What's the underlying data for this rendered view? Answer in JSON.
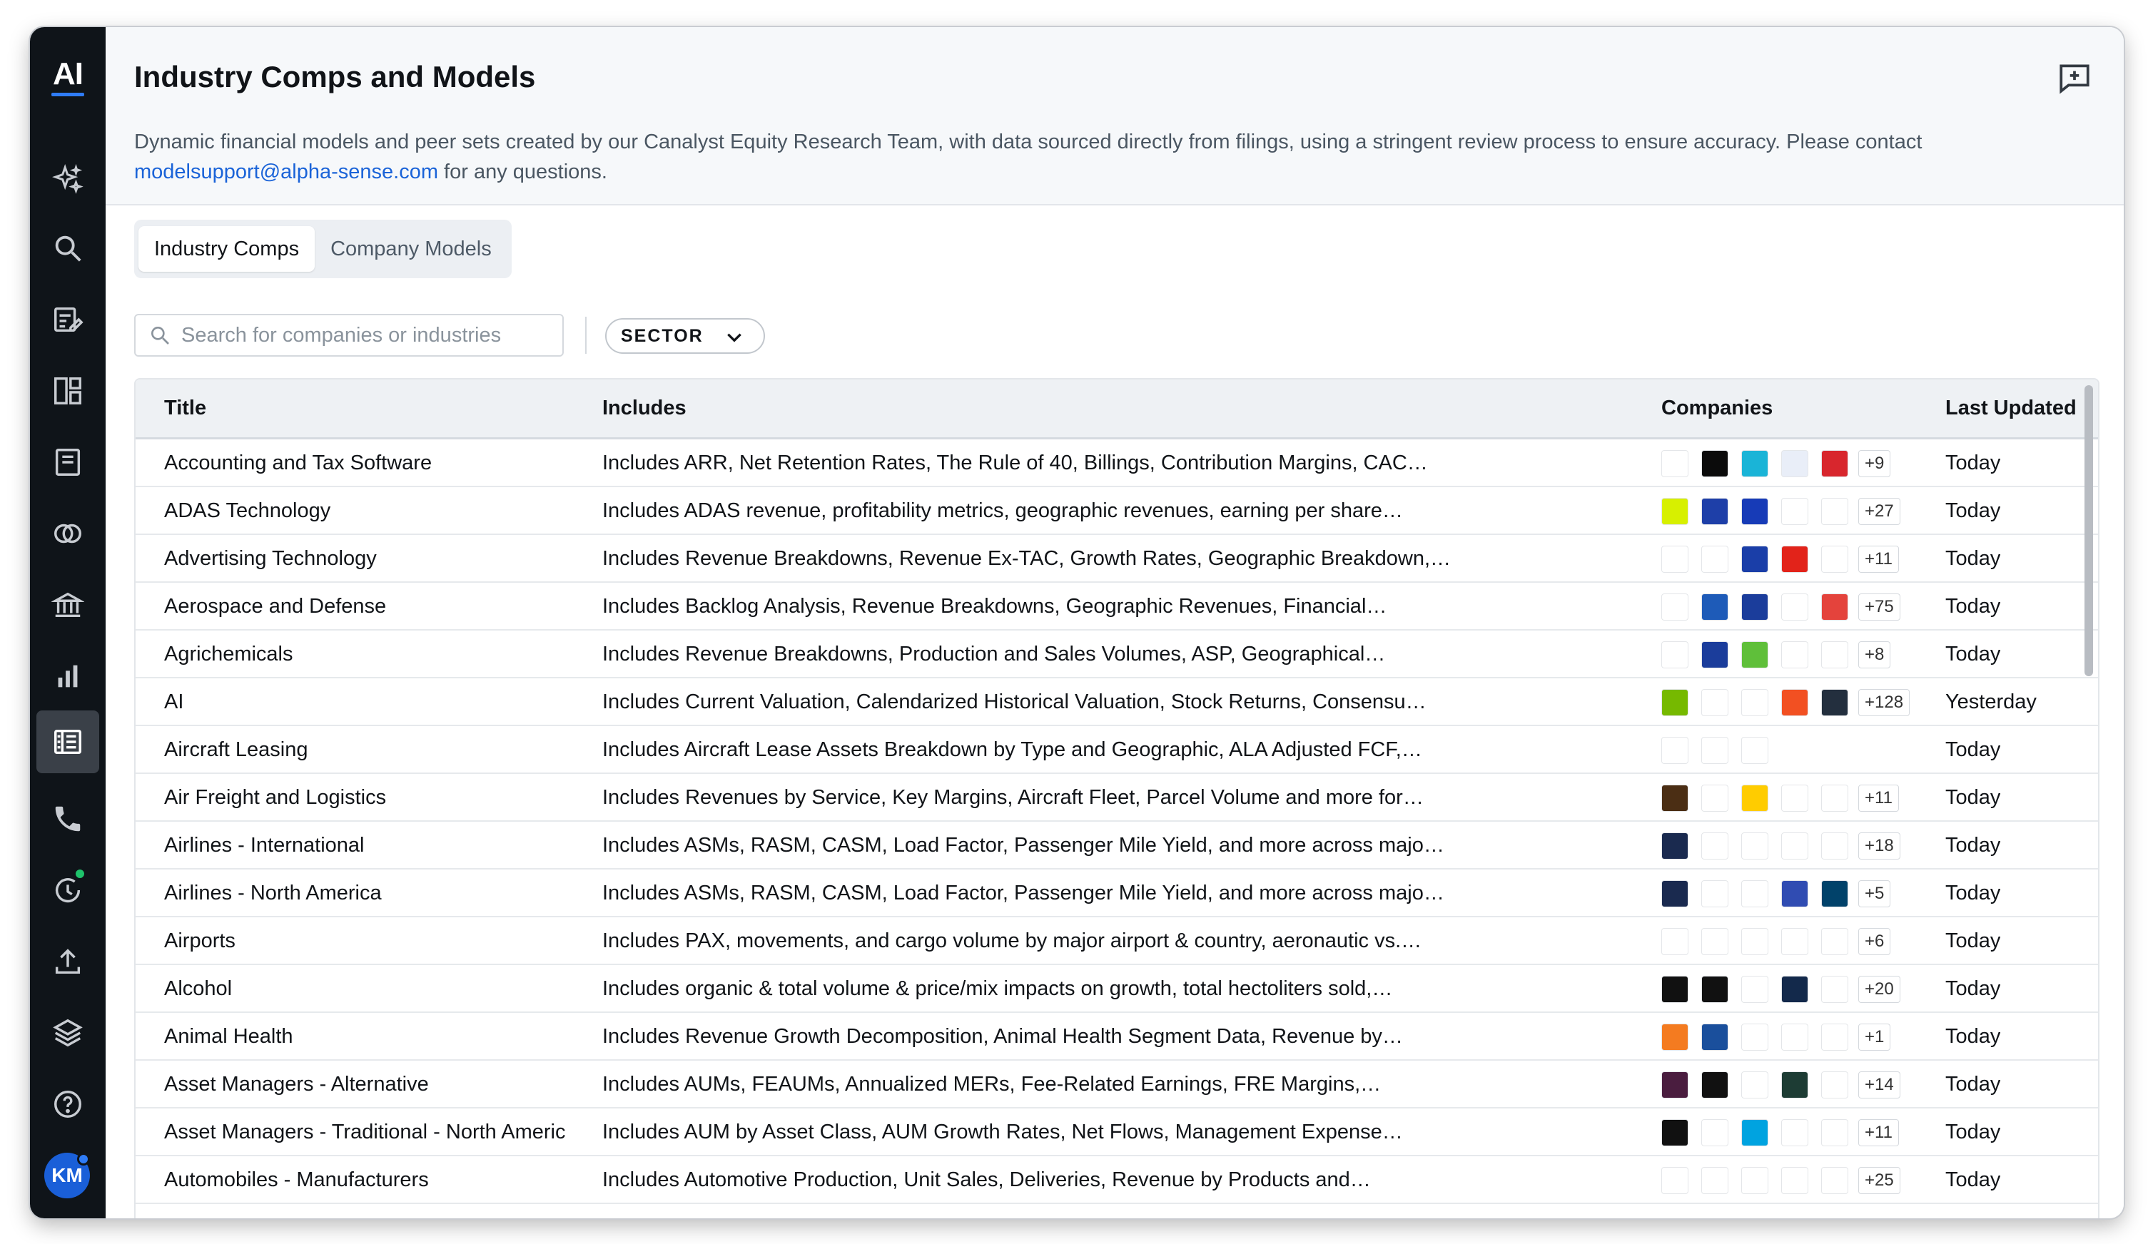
{
  "app": {
    "logo_text": "AI",
    "avatar_initials": "KM"
  },
  "sidebar": {
    "items": [
      {
        "icon": "sparkle-icon",
        "active": false
      },
      {
        "icon": "search-icon",
        "active": false
      },
      {
        "icon": "document-edit-icon",
        "active": false
      },
      {
        "icon": "dashboard-icon",
        "active": false
      },
      {
        "icon": "notebook-icon",
        "active": false
      },
      {
        "icon": "link-icon",
        "active": false
      },
      {
        "icon": "bank-icon",
        "active": false
      },
      {
        "icon": "bar-chart-icon",
        "active": false
      },
      {
        "icon": "table-list-icon",
        "active": true
      },
      {
        "icon": "phone-icon",
        "active": false
      },
      {
        "icon": "refresh-notification-icon",
        "active": false
      },
      {
        "icon": "upload-icon",
        "active": false
      },
      {
        "icon": "layers-icon",
        "active": false
      },
      {
        "icon": "help-icon",
        "active": false
      }
    ]
  },
  "header": {
    "title": "Industry Comps and Models",
    "description_text": "Dynamic financial models and peer sets created by our Canalyst Equity Research Team, with data sourced directly from filings, using a stringent review process to ensure accuracy. Please contact",
    "contact_email": "modelsupport@alpha-sense.com",
    "description_suffix": " for any questions."
  },
  "tabs": [
    {
      "label": "Industry Comps",
      "active": true
    },
    {
      "label": "Company Models",
      "active": false
    }
  ],
  "filters": {
    "search_placeholder": "Search for companies or industries",
    "sector_label": "SECTOR"
  },
  "table": {
    "columns": {
      "title": "Title",
      "includes": "Includes",
      "companies": "Companies",
      "updated": "Last Updated"
    },
    "rows": [
      {
        "title": "Accounting and Tax Software",
        "includes": "Includes ARR, Net Retention Rates, The Rule of 40, Billings, Contribution Margins, CAC…",
        "more": "+9",
        "updated": "Today",
        "logos": [
          "#ffffff",
          "#0b0b0b",
          "#1ab4d7",
          "#e9eef8",
          "#d8262d"
        ]
      },
      {
        "title": "ADAS Technology",
        "includes": "Includes ADAS revenue, profitability metrics, geographic revenues, earning per share…",
        "more": "+27",
        "updated": "Today",
        "logos": [
          "#d7f000",
          "#1e3fa8",
          "#173bb7",
          "#ffffff",
          "#ffffff"
        ]
      },
      {
        "title": "Advertising Technology",
        "includes": "Includes Revenue Breakdowns, Revenue Ex-TAC, Growth Rates, Geographic Breakdown,…",
        "more": "+11",
        "updated": "Today",
        "logos": [
          "#ffffff",
          "#ffffff",
          "#1a3ea8",
          "#e2231a",
          "#ffffff"
        ]
      },
      {
        "title": "Aerospace and Defense",
        "includes": "Includes Backlog Analysis, Revenue Breakdowns, Geographic Revenues, Financial…",
        "more": "+75",
        "updated": "Today",
        "logos": [
          "#ffffff",
          "#1e5bb8",
          "#1b3d9b",
          "#ffffff",
          "#e4433c"
        ]
      },
      {
        "title": "Agrichemicals",
        "includes": "Includes Revenue Breakdowns, Production and Sales Volumes, ASP, Geographical…",
        "more": "+8",
        "updated": "Today",
        "logos": [
          "#ffffff",
          "#1b3d9b",
          "#5fbf3a",
          "#ffffff",
          "#ffffff"
        ]
      },
      {
        "title": "AI",
        "includes": "Includes Current Valuation, Calendarized Historical Valuation, Stock Returns, Consensu…",
        "more": "+128",
        "updated": "Yesterday",
        "logos": [
          "#76b900",
          "#ffffff",
          "#ffffff",
          "#f25022",
          "#232f3e"
        ]
      },
      {
        "title": "Aircraft Leasing",
        "includes": "Includes Aircraft Lease Assets Breakdown by Type and Geographic, ALA Adjusted FCF,…",
        "more": "",
        "updated": "Today",
        "logos": [
          "#ffffff",
          "#ffffff",
          "#ffffff"
        ]
      },
      {
        "title": "Air Freight and Logistics",
        "includes": "Includes Revenues by Service, Key Margins, Aircraft Fleet, Parcel Volume and more for…",
        "more": "+11",
        "updated": "Today",
        "logos": [
          "#4b2e14",
          "#ffffff",
          "#ffcc00",
          "#ffffff",
          "#ffffff"
        ]
      },
      {
        "title": "Airlines - International",
        "includes": "Includes ASMs, RASM, CASM, Load Factor, Passenger Mile Yield, and more across majo…",
        "more": "+18",
        "updated": "Today",
        "logos": [
          "#1a2a4f",
          "#ffffff",
          "#ffffff",
          "#ffffff",
          "#ffffff"
        ]
      },
      {
        "title": "Airlines - North America",
        "includes": "Includes ASMs, RASM, CASM, Load Factor, Passenger Mile Yield, and more across majo…",
        "more": "+5",
        "updated": "Today",
        "logos": [
          "#1a2a4f",
          "#ffffff",
          "#ffffff",
          "#304cb2",
          "#01426a"
        ]
      },
      {
        "title": "Airports",
        "includes": "Includes PAX, movements, and cargo volume by major airport & country, aeronautic vs.…",
        "more": "+6",
        "updated": "Today",
        "logos": [
          "#ffffff",
          "#ffffff",
          "#ffffff",
          "#ffffff",
          "#ffffff"
        ]
      },
      {
        "title": "Alcohol",
        "includes": "Includes organic & total volume & price/mix impacts on growth, total hectoliters sold,…",
        "more": "+20",
        "updated": "Today",
        "logos": [
          "#111111",
          "#111111",
          "#ffffff",
          "#13294b",
          "#ffffff"
        ]
      },
      {
        "title": "Animal Health",
        "includes": "Includes Revenue Growth Decomposition, Animal Health Segment Data, Revenue by…",
        "more": "+1",
        "updated": "Today",
        "logos": [
          "#f47b20",
          "#1a4f9c",
          "#ffffff",
          "#ffffff",
          "#ffffff"
        ]
      },
      {
        "title": "Asset Managers - Alternative",
        "includes": "Includes AUMs, FEAUMs, Annualized MERs, Fee-Related Earnings, FRE Margins,…",
        "more": "+14",
        "updated": "Today",
        "logos": [
          "#4a1d3f",
          "#111111",
          "#ffffff",
          "#1d3c34",
          "#ffffff"
        ]
      },
      {
        "title": "Asset Managers - Traditional - North Americ",
        "includes": "Includes AUM by Asset Class, AUM Growth Rates, Net Flows, Management Expense…",
        "more": "+11",
        "updated": "Today",
        "logos": [
          "#111111",
          "#ffffff",
          "#00a3e0",
          "#ffffff",
          "#ffffff"
        ]
      },
      {
        "title": "Automobiles - Manufacturers",
        "includes": "Includes Automotive Production, Unit Sales, Deliveries, Revenue by Products and…",
        "more": "+25",
        "updated": "Today",
        "logos": [
          "#ffffff",
          "#ffffff",
          "#ffffff",
          "#ffffff",
          "#ffffff"
        ]
      }
    ]
  }
}
